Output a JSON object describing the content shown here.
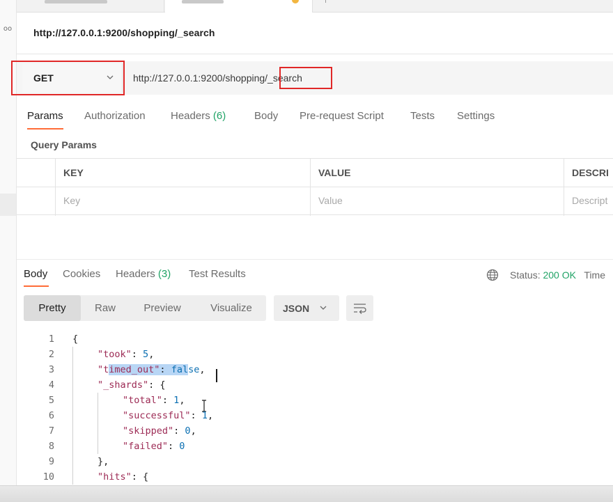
{
  "request": {
    "title": "http://127.0.0.1:9200/shopping/_search",
    "method": "GET",
    "url": "http://127.0.0.1:9200/shopping/_search"
  },
  "request_tabs": [
    {
      "label": "Params",
      "count": ""
    },
    {
      "label": "Authorization",
      "count": ""
    },
    {
      "label": "Headers",
      "count": "(6)"
    },
    {
      "label": "Body",
      "count": ""
    },
    {
      "label": "Pre-request Script",
      "count": ""
    },
    {
      "label": "Tests",
      "count": ""
    },
    {
      "label": "Settings",
      "count": ""
    }
  ],
  "query_params": {
    "title": "Query Params",
    "columns": [
      "KEY",
      "VALUE",
      "DESCRI"
    ],
    "placeholders": [
      "Key",
      "Value",
      "Descript"
    ]
  },
  "response_tabs": [
    {
      "label": "Body",
      "count": ""
    },
    {
      "label": "Cookies",
      "count": ""
    },
    {
      "label": "Headers",
      "count": "(3)"
    },
    {
      "label": "Test Results",
      "count": ""
    }
  ],
  "status": {
    "label": "Status:",
    "value": "200 OK",
    "extra": "Time"
  },
  "format_buttons": [
    "Pretty",
    "Raw",
    "Preview",
    "Visualize"
  ],
  "format_select": "JSON",
  "code_lines": [
    {
      "n": "1",
      "indent": 0,
      "tokens": [
        {
          "t": "{",
          "c": "p"
        }
      ]
    },
    {
      "n": "2",
      "indent": 1,
      "tokens": [
        {
          "t": "\"took\"",
          "c": "key"
        },
        {
          "t": ": ",
          "c": "p"
        },
        {
          "t": "5",
          "c": "num"
        },
        {
          "t": ",",
          "c": "p"
        }
      ]
    },
    {
      "n": "3",
      "indent": 1,
      "tokens": [
        {
          "t": "\"t",
          "c": "key"
        },
        {
          "t": "imed_out\"",
          "c": "key sel"
        },
        {
          "t": ": ",
          "c": "p sel"
        },
        {
          "t": "fal",
          "c": "bool sel"
        },
        {
          "t": "se",
          "c": "bool"
        },
        {
          "t": ",",
          "c": "p"
        }
      ]
    },
    {
      "n": "4",
      "indent": 1,
      "tokens": [
        {
          "t": "\"_shards\"",
          "c": "key"
        },
        {
          "t": ": {",
          "c": "p"
        }
      ]
    },
    {
      "n": "5",
      "indent": 2,
      "tokens": [
        {
          "t": "\"total\"",
          "c": "key"
        },
        {
          "t": ": ",
          "c": "p"
        },
        {
          "t": "1",
          "c": "num"
        },
        {
          "t": ",",
          "c": "p"
        }
      ]
    },
    {
      "n": "6",
      "indent": 2,
      "tokens": [
        {
          "t": "\"successful\"",
          "c": "key"
        },
        {
          "t": ": ",
          "c": "p"
        },
        {
          "t": "1",
          "c": "num"
        },
        {
          "t": ",",
          "c": "p"
        }
      ]
    },
    {
      "n": "7",
      "indent": 2,
      "tokens": [
        {
          "t": "\"skipped\"",
          "c": "key"
        },
        {
          "t": ": ",
          "c": "p"
        },
        {
          "t": "0",
          "c": "num"
        },
        {
          "t": ",",
          "c": "p"
        }
      ]
    },
    {
      "n": "8",
      "indent": 2,
      "tokens": [
        {
          "t": "\"failed\"",
          "c": "key"
        },
        {
          "t": ": ",
          "c": "p"
        },
        {
          "t": "0",
          "c": "num"
        }
      ]
    },
    {
      "n": "9",
      "indent": 1,
      "tokens": [
        {
          "t": "},",
          "c": "p"
        }
      ]
    },
    {
      "n": "10",
      "indent": 1,
      "tokens": [
        {
          "t": "\"hits\"",
          "c": "key"
        },
        {
          "t": ": {",
          "c": "p"
        }
      ]
    }
  ],
  "colors": {
    "accent": "#ff6c37",
    "status_ok": "#21a366",
    "highlight_box": "#e02727",
    "json_key": "#9c2a54",
    "json_value": "#0b6fb2"
  },
  "icons": [
    "chevron-down-icon",
    "globe-icon",
    "wrap-lines-icon",
    "text-cursor-icon"
  ]
}
